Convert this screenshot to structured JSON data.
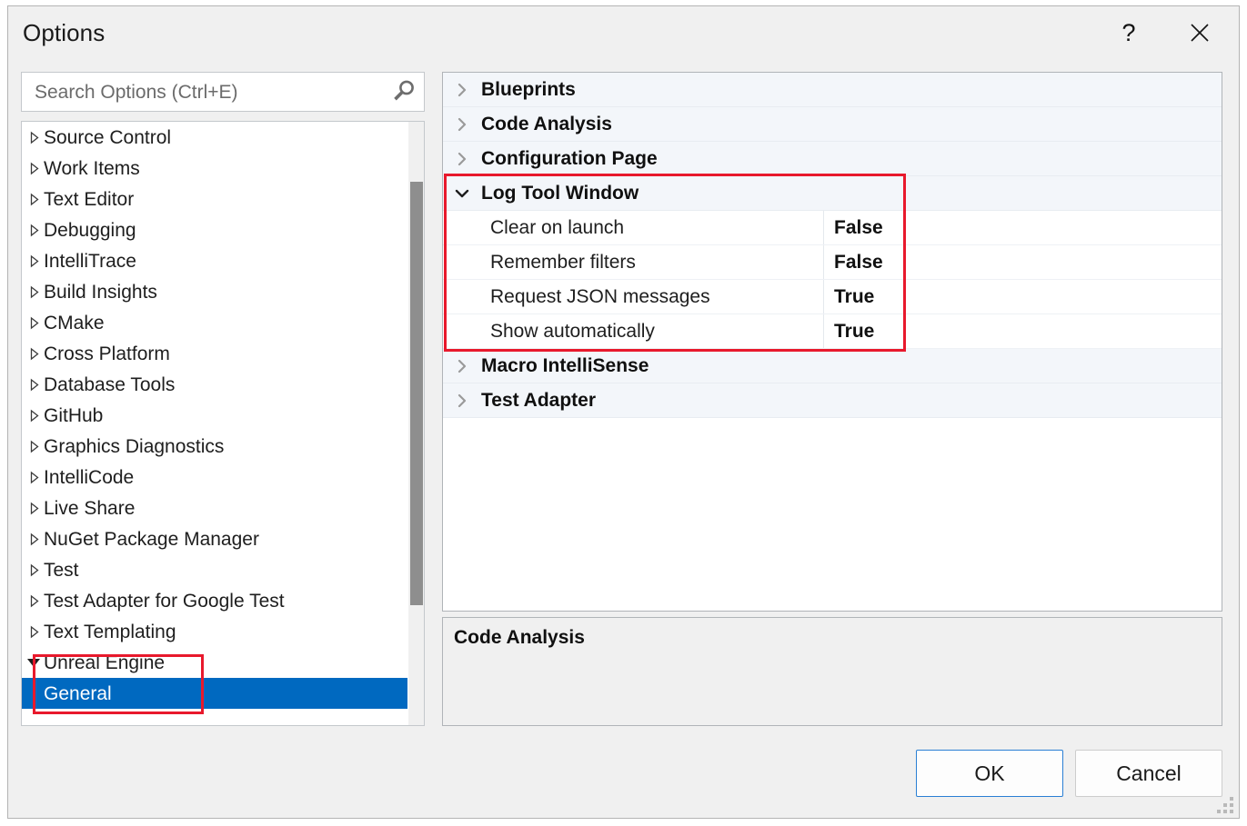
{
  "window": {
    "title": "Options",
    "help_glyph": "?",
    "close_glyph": "✕"
  },
  "search": {
    "placeholder": "Search Options (Ctrl+E)",
    "value": "",
    "icon": "search-icon"
  },
  "tree": {
    "items": [
      {
        "label": "Source Control",
        "state": "collapsed",
        "level": 0,
        "selected": false
      },
      {
        "label": "Work Items",
        "state": "collapsed",
        "level": 0,
        "selected": false
      },
      {
        "label": "Text Editor",
        "state": "collapsed",
        "level": 0,
        "selected": false
      },
      {
        "label": "Debugging",
        "state": "collapsed",
        "level": 0,
        "selected": false
      },
      {
        "label": "IntelliTrace",
        "state": "collapsed",
        "level": 0,
        "selected": false
      },
      {
        "label": "Build Insights",
        "state": "collapsed",
        "level": 0,
        "selected": false
      },
      {
        "label": "CMake",
        "state": "collapsed",
        "level": 0,
        "selected": false
      },
      {
        "label": "Cross Platform",
        "state": "collapsed",
        "level": 0,
        "selected": false
      },
      {
        "label": "Database Tools",
        "state": "collapsed",
        "level": 0,
        "selected": false
      },
      {
        "label": "GitHub",
        "state": "collapsed",
        "level": 0,
        "selected": false
      },
      {
        "label": "Graphics Diagnostics",
        "state": "collapsed",
        "level": 0,
        "selected": false
      },
      {
        "label": "IntelliCode",
        "state": "collapsed",
        "level": 0,
        "selected": false
      },
      {
        "label": "Live Share",
        "state": "collapsed",
        "level": 0,
        "selected": false
      },
      {
        "label": "NuGet Package Manager",
        "state": "collapsed",
        "level": 0,
        "selected": false
      },
      {
        "label": "Test",
        "state": "collapsed",
        "level": 0,
        "selected": false
      },
      {
        "label": "Test Adapter for Google Test",
        "state": "collapsed",
        "level": 0,
        "selected": false
      },
      {
        "label": "Text Templating",
        "state": "collapsed",
        "level": 0,
        "selected": false
      },
      {
        "label": "Unreal Engine",
        "state": "expanded",
        "level": 0,
        "selected": false
      },
      {
        "label": "General",
        "state": "leaf",
        "level": 1,
        "selected": true
      }
    ],
    "selected_label": "General"
  },
  "grid": {
    "rows": [
      {
        "kind": "category",
        "label": "Blueprints",
        "state": "collapsed"
      },
      {
        "kind": "category",
        "label": "Code Analysis",
        "state": "collapsed"
      },
      {
        "kind": "category",
        "label": "Configuration Page",
        "state": "collapsed"
      },
      {
        "kind": "category",
        "label": "Log Tool Window",
        "state": "expanded"
      },
      {
        "kind": "property",
        "label": "Clear on launch",
        "value": "False"
      },
      {
        "kind": "property",
        "label": "Remember filters",
        "value": "False"
      },
      {
        "kind": "property",
        "label": "Request JSON messages",
        "value": "True"
      },
      {
        "kind": "property",
        "label": "Show automatically",
        "value": "True"
      },
      {
        "kind": "category",
        "label": "Macro IntelliSense",
        "state": "collapsed"
      },
      {
        "kind": "category",
        "label": "Test Adapter",
        "state": "collapsed"
      }
    ],
    "chevron_collapsed": "›",
    "chevron_expanded": "⌄"
  },
  "description": {
    "title": "Code Analysis",
    "body": ""
  },
  "footer": {
    "ok_label": "OK",
    "cancel_label": "Cancel"
  },
  "annotations": {
    "tree_highlight": "Unreal Engine / General",
    "grid_highlight": "Log Tool Window",
    "color": "#e8192c"
  },
  "colors": {
    "selection": "#0069c0",
    "annotation": "#e8192c",
    "category_row_bg": "#f3f6fa",
    "dialog_bg": "#f0f0f0",
    "accent_focus": "#2a7fd4"
  }
}
